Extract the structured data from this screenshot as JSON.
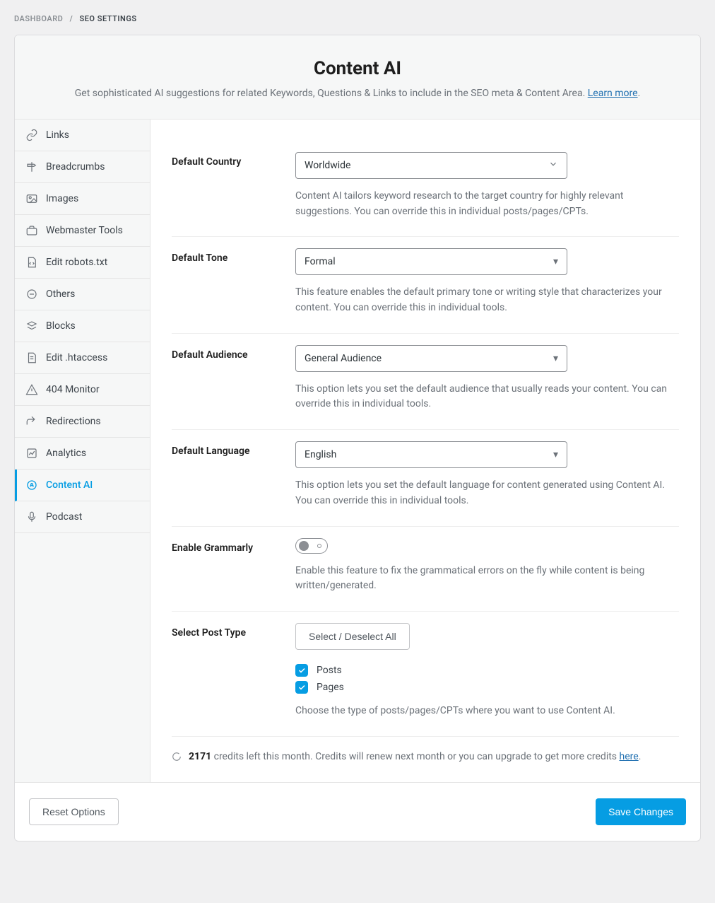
{
  "breadcrumbs": {
    "dashboard": "DASHBOARD",
    "separator": "/",
    "current": "SEO SETTINGS"
  },
  "header": {
    "title": "Content AI",
    "description": "Get sophisticated AI suggestions for related Keywords, Questions & Links to include in the SEO meta & Content Area. ",
    "learn_more": "Learn more"
  },
  "sidebar": {
    "items": [
      {
        "label": "Links"
      },
      {
        "label": "Breadcrumbs"
      },
      {
        "label": "Images"
      },
      {
        "label": "Webmaster Tools"
      },
      {
        "label": "Edit robots.txt"
      },
      {
        "label": "Others"
      },
      {
        "label": "Blocks"
      },
      {
        "label": "Edit .htaccess"
      },
      {
        "label": "404 Monitor"
      },
      {
        "label": "Redirections"
      },
      {
        "label": "Analytics"
      },
      {
        "label": "Content AI"
      },
      {
        "label": "Podcast"
      }
    ]
  },
  "fields": {
    "country": {
      "label": "Default Country",
      "value": "Worldwide",
      "desc": "Content AI tailors keyword research to the target country for highly relevant suggestions. You can override this in individual posts/pages/CPTs."
    },
    "tone": {
      "label": "Default Tone",
      "value": "Formal",
      "desc": "This feature enables the default primary tone or writing style that characterizes your content. You can override this in individual tools."
    },
    "audience": {
      "label": "Default Audience",
      "value": "General Audience",
      "desc": "This option lets you set the default audience that usually reads your content. You can override this in individual tools."
    },
    "language": {
      "label": "Default Language",
      "value": "English",
      "desc": "This option lets you set the default language for content generated using Content AI. You can override this in individual tools."
    },
    "grammarly": {
      "label": "Enable Grammarly",
      "desc": "Enable this feature to fix the grammatical errors on the fly while content is being written/generated."
    },
    "posttype": {
      "label": "Select Post Type",
      "button": "Select / Deselect All",
      "options": {
        "posts": "Posts",
        "pages": "Pages"
      },
      "desc": "Choose the type of posts/pages/CPTs where you want to use Content AI."
    }
  },
  "credits": {
    "count": "2171",
    "text_after_count": " credits left this month. Credits will renew next month or you can upgrade to get more credits ",
    "link": "here"
  },
  "footer": {
    "reset": "Reset Options",
    "save": "Save Changes"
  }
}
